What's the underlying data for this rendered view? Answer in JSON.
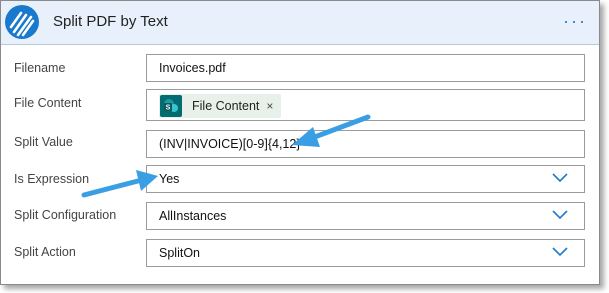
{
  "header": {
    "title": "Split PDF by Text",
    "menu_label": "···",
    "logo_icon": "stripes-logo-icon",
    "color": "#1979cd"
  },
  "fields": {
    "filename": {
      "label": "Filename",
      "value": "Invoices.pdf"
    },
    "file_content": {
      "label": "File Content",
      "token_label": "File Content",
      "token_icon": "sharepoint-icon",
      "remove": "×"
    },
    "split_value": {
      "label": "Split Value",
      "value": "(INV|INVOICE)[0-9]{4,12}"
    },
    "is_expression": {
      "label": "Is Expression",
      "value": "Yes"
    },
    "split_configuration": {
      "label": "Split Configuration",
      "value": "AllInstances"
    },
    "split_action": {
      "label": "Split Action",
      "value": "SplitOn"
    }
  },
  "accent": "#1e7ad1",
  "annotation_arrow_color": "#3a9ee4"
}
